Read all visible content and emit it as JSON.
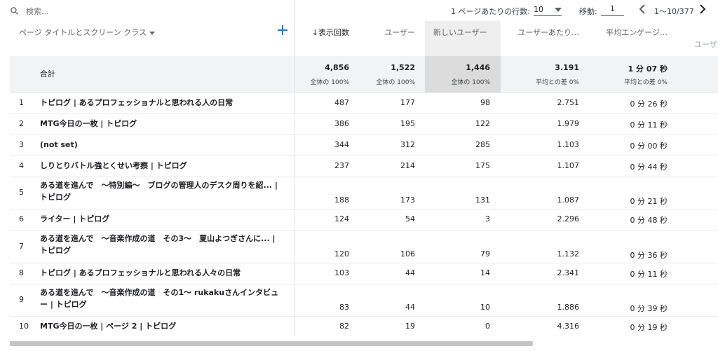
{
  "search": {
    "placeholder": "検索..."
  },
  "pagination": {
    "rows_label": "1 ページあたりの行数:",
    "rows_value": "10",
    "goto_label": "移動:",
    "goto_value": "1",
    "range": "1〜10/377"
  },
  "columns": {
    "dimension": "ページ タイトルとスクリーン クラス",
    "views": "表示回数",
    "users": "ユーザー",
    "new_users": "新しいユーザー",
    "per_user": "ユーザーあたり…",
    "avg_engagement": "平均エンゲージ…",
    "cut_off": "ユーザ"
  },
  "summary": {
    "label": "合計",
    "views": "4,856",
    "views_sub": "全体の 100%",
    "users": "1,522",
    "users_sub": "全体の 100%",
    "new_users": "1,446",
    "new_users_sub": "全体の 100%",
    "per_user": "3.191",
    "per_user_sub": "平均との差 0%",
    "avg": "1 分 07 秒",
    "avg_sub": "平均との差 0%"
  },
  "rows": [
    {
      "n": "1",
      "title": "トピログ | あるプロフェッショナルと思われる人の日常",
      "views": "487",
      "users": "177",
      "new": "98",
      "per": "2.751",
      "avg": "0 分 26 秒"
    },
    {
      "n": "2",
      "title": "MTG今日の一枚 | トピログ",
      "views": "386",
      "users": "195",
      "new": "122",
      "per": "1.979",
      "avg": "0 分 11 秒"
    },
    {
      "n": "3",
      "title": "(not set)",
      "views": "344",
      "users": "312",
      "new": "285",
      "per": "1.103",
      "avg": "0 分 00 秒"
    },
    {
      "n": "4",
      "title": "しりとりバトル強とくせい考察 | トピログ",
      "views": "237",
      "users": "214",
      "new": "175",
      "per": "1.107",
      "avg": "0 分 44 秒"
    },
    {
      "n": "5",
      "title": "ある道を進んで　〜特別編〜　ブログの管理人のデスク周りを紹... | トピログ",
      "views": "188",
      "users": "173",
      "new": "131",
      "per": "1.087",
      "avg": "0 分 21 秒"
    },
    {
      "n": "6",
      "title": "ライター | トピログ",
      "views": "124",
      "users": "54",
      "new": "3",
      "per": "2.296",
      "avg": "0 分 48 秒"
    },
    {
      "n": "7",
      "title": "ある道を進んで　〜音楽作成の道　その3〜　夏山よつぎさんに... | トピログ",
      "views": "120",
      "users": "106",
      "new": "79",
      "per": "1.132",
      "avg": "0 分 36 秒"
    },
    {
      "n": "8",
      "title": "トピログ | あるプロフェッショナルと思われる人々の日常",
      "views": "103",
      "users": "44",
      "new": "14",
      "per": "2.341",
      "avg": "0 分 11 秒"
    },
    {
      "n": "9",
      "title": "ある道を進んで　〜音楽作成の道　その1〜 rukakuさんインタビュー | トピログ",
      "views": "83",
      "users": "44",
      "new": "10",
      "per": "1.886",
      "avg": "0 分 39 秒"
    },
    {
      "n": "10",
      "title": "MTG今日の一枚 | ページ 2 | トピログ",
      "views": "82",
      "users": "19",
      "new": "0",
      "per": "4.316",
      "avg": "0 分 19 秒"
    }
  ],
  "colors": {
    "accent": "#1a73e8",
    "highlight": "#dcdcdc"
  }
}
